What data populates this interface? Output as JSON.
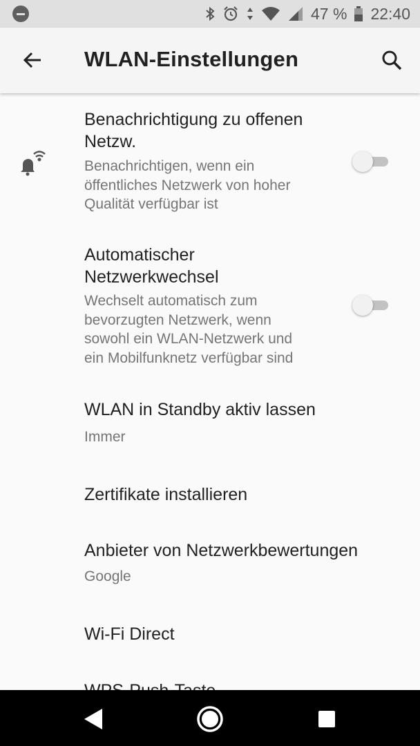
{
  "status_bar": {
    "battery_percent": "47 %",
    "time": "22:40",
    "icons": [
      "do-not-disturb-icon",
      "bluetooth-icon",
      "alarm-icon",
      "data-arrows-icon",
      "wifi-icon",
      "signal-icon",
      "battery-icon"
    ]
  },
  "app_bar": {
    "title": "WLAN-Einstellungen",
    "icons": [
      "back-arrow-icon",
      "search-icon"
    ]
  },
  "settings": {
    "notify_open_networks": {
      "title_line1": "Benachrichtigung zu offenen",
      "title_line2": "Netzw.",
      "summary_line1": "Benachrichtigen, wenn ein",
      "summary_line2": "öffentliches Netzwerk von hoher",
      "summary_line3": "Qualität verfügbar ist",
      "enabled": false,
      "icon": "wifi-notification-bell-icon"
    },
    "auto_network_switch": {
      "title_line1": "Automatischer",
      "title_line2": "Netzwerkwechsel",
      "summary_line1": "Wechselt automatisch zum",
      "summary_line2": "bevorzugten Netzwerk, wenn",
      "summary_line3": "sowohl ein WLAN-Netzwerk und",
      "summary_line4": "ein Mobilfunknetz verfügbar sind",
      "enabled": false
    },
    "standby": {
      "title": "WLAN in Standby aktiv lassen",
      "summary": "Immer"
    },
    "certificates": {
      "title": "Zertifikate installieren"
    },
    "network_rating": {
      "title": "Anbieter von Netzwerkbewertungen",
      "summary": "Google"
    },
    "wifi_direct": {
      "title": "Wi-Fi Direct"
    },
    "wps_push": {
      "title": "WPS-Push-Taste"
    }
  },
  "nav_bar": {
    "icons": [
      "back-triangle-icon",
      "home-circle-icon",
      "recents-square-icon"
    ]
  },
  "colors": {
    "background": "#fafafa",
    "status_bar": "#e0e0e0",
    "app_bar": "#f5f5f5",
    "primary_text": "#212121",
    "secondary_text": "#757575",
    "toggle_off_track": "#c2c2c2",
    "nav_bar": "#000000"
  }
}
